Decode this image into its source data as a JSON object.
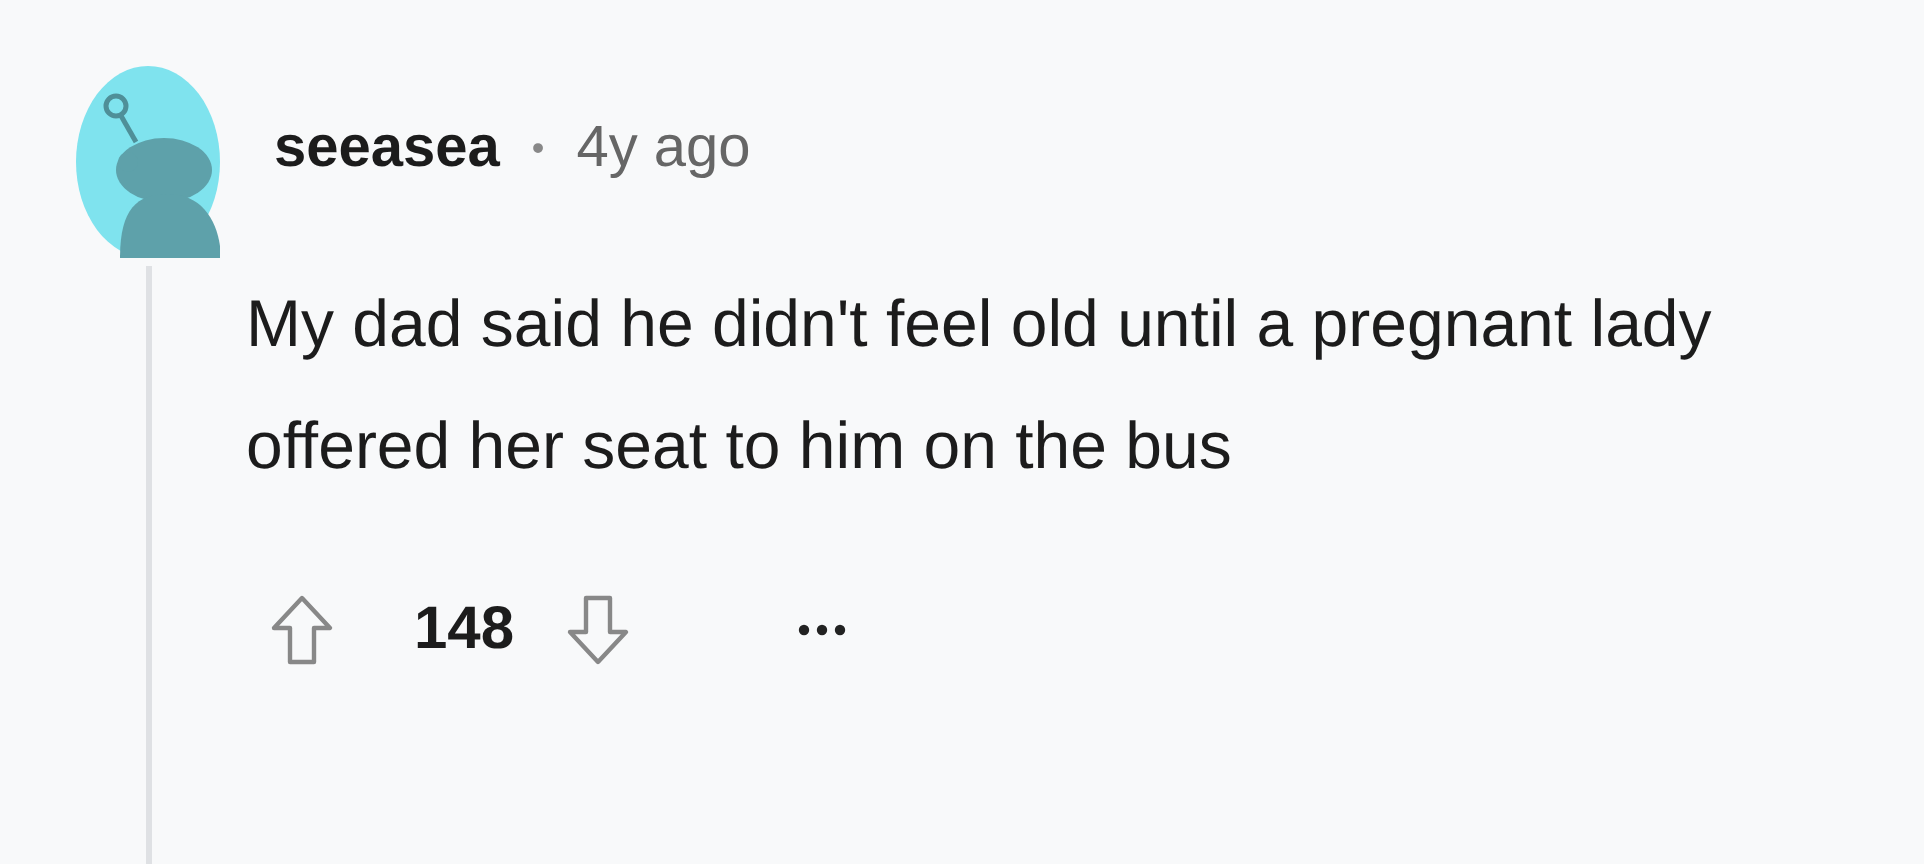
{
  "comment": {
    "author": "seeasea",
    "separator": "•",
    "age": "4y ago",
    "body": "My dad said he didn't feel old until a pregnant lady offered her seat to him on the bus",
    "score": "148"
  }
}
